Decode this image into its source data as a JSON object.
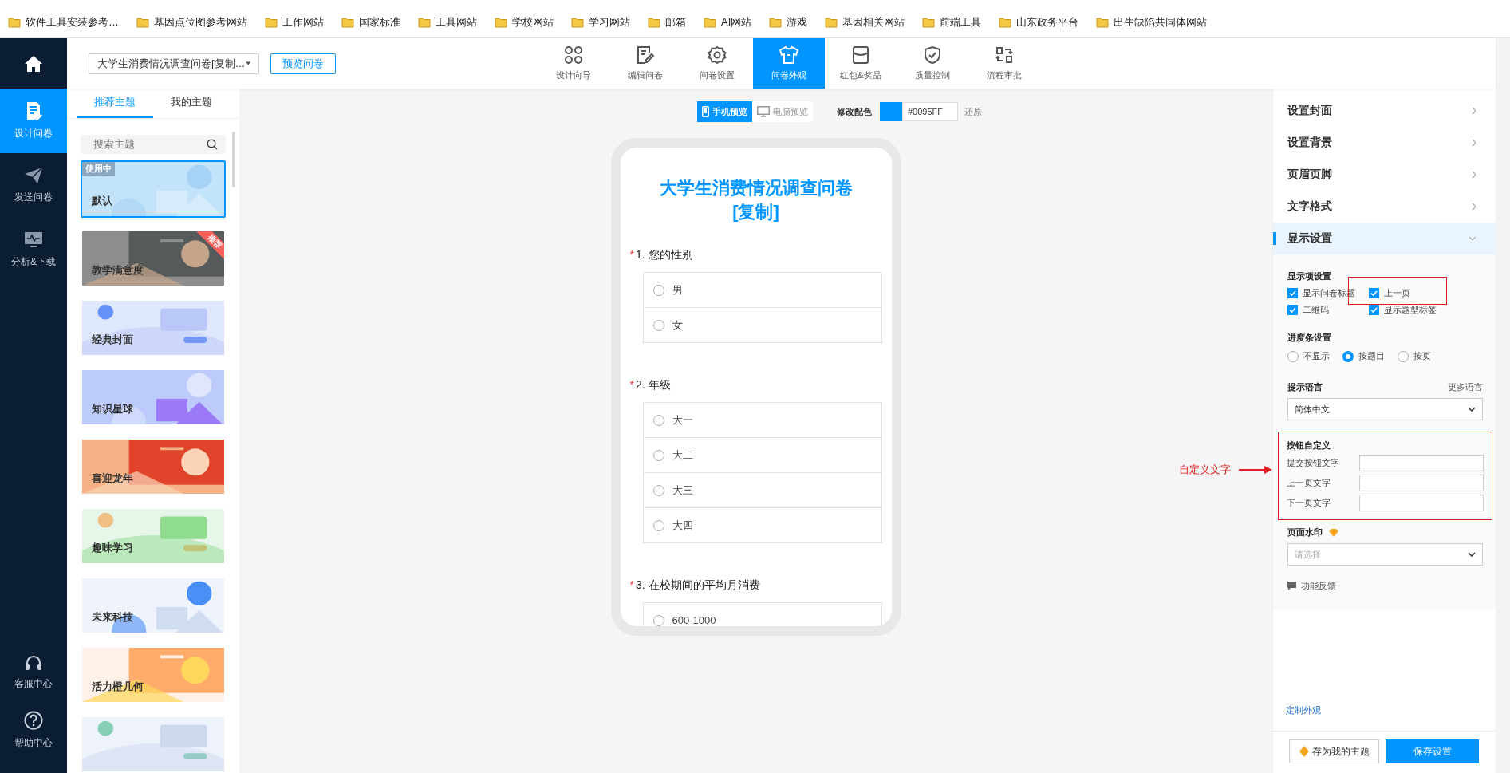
{
  "bookmarks": [
    "软件工具安装参考…",
    "基因点位图参考网站",
    "工作网站",
    "国家标准",
    "工具网站",
    "学校网站",
    "学习网站",
    "邮箱",
    "AI网站",
    "游戏",
    "基因相关网站",
    "前端工具",
    "山东政务平台",
    "出生缺陷共同体网站"
  ],
  "app_nav": {
    "items": [
      {
        "label": "设计问卷",
        "kind": "doc",
        "selected": true
      },
      {
        "label": "发送问卷",
        "kind": "plane",
        "selected": false
      },
      {
        "label": "分析&下载",
        "kind": "monitor",
        "selected": false
      }
    ],
    "bottom": [
      {
        "label": "客服中心",
        "kind": "headset"
      },
      {
        "label": "帮助中心",
        "kind": "help"
      }
    ]
  },
  "header": {
    "survey_select": "大学生消费情况调查问卷[复制…",
    "preview_button": "预览问卷",
    "tabs": [
      {
        "label": "设计向导",
        "kind": "grid",
        "selected": false
      },
      {
        "label": "编辑问卷",
        "kind": "edit",
        "selected": false
      },
      {
        "label": "问卷设置",
        "kind": "gear",
        "selected": false
      },
      {
        "label": "问卷外观",
        "kind": "shirt",
        "selected": true
      },
      {
        "label": "红包&奖品",
        "kind": "box",
        "selected": false
      },
      {
        "label": "质量控制",
        "kind": "shield",
        "selected": false
      },
      {
        "label": "流程审批",
        "kind": "flow",
        "selected": false
      }
    ]
  },
  "theme_panel": {
    "tabs": [
      {
        "label": "推荐主题",
        "selected": true
      },
      {
        "label": "我的主题",
        "selected": false
      }
    ],
    "search": {
      "placeholder": "搜索主题"
    },
    "themes": [
      {
        "label": "默认",
        "badge": "使用中",
        "selected": true
      },
      {
        "label": "教学满意度",
        "tag": "推荐",
        "selected": false
      },
      {
        "label": "经典封面",
        "selected": false
      },
      {
        "label": "知识星球",
        "selected": false
      },
      {
        "label": "喜迎龙年",
        "selected": false
      },
      {
        "label": "趣味学习",
        "selected": false
      },
      {
        "label": "未来科技",
        "selected": false
      },
      {
        "label": "活力橙几何",
        "selected": false
      },
      {
        "selected": false
      }
    ]
  },
  "preview": {
    "modes": [
      {
        "label": "手机预览",
        "kind": "phone",
        "selected": true
      },
      {
        "label": "电脑预览",
        "kind": "desktop",
        "selected": false
      }
    ],
    "color_label": "修改配色",
    "color": "#0095ff",
    "color_value": "#0095FF",
    "reset": "还原",
    "survey": {
      "title": "大学生消费情况调查问卷[复制]",
      "required_mark": "*",
      "questions": [
        {
          "number": "1.",
          "title": "您的性别",
          "required": true,
          "options": [
            "男",
            "女"
          ]
        },
        {
          "number": "2.",
          "title": "年级",
          "required": true,
          "options": [
            "大一",
            "大二",
            "大三",
            "大四"
          ]
        },
        {
          "number": "3.",
          "title": "在校期间的平均月消费",
          "required": true,
          "options": [
            "600-1000"
          ]
        }
      ]
    }
  },
  "settings_panel": {
    "sections": [
      {
        "label": "设置封面",
        "expanded": false
      },
      {
        "label": "设置背景",
        "expanded": false
      },
      {
        "label": "页眉页脚",
        "expanded": false
      },
      {
        "label": "文字格式",
        "expanded": false
      },
      {
        "label": "显示设置",
        "expanded": true
      }
    ],
    "display": {
      "heading": "显示项设置",
      "items": [
        {
          "label": "显示问卷标题",
          "checked": true,
          "highlighted": false
        },
        {
          "label": "上一页",
          "checked": true,
          "highlighted": true
        },
        {
          "label": "二维码",
          "checked": true,
          "highlighted": false
        },
        {
          "label": "显示题型标签",
          "checked": true,
          "highlighted": false
        }
      ]
    },
    "progress": {
      "heading": "进度条设置",
      "options": [
        {
          "label": "不显示",
          "selected": false
        },
        {
          "label": "按题目",
          "selected": true
        },
        {
          "label": "按页",
          "selected": false
        }
      ]
    },
    "language": {
      "heading": "提示语言",
      "more": "更多语言",
      "value": "简体中文"
    },
    "button_text": {
      "heading": "按钮自定义",
      "highlighted": true,
      "fields": [
        {
          "label": "提交按钮文字"
        },
        {
          "label": "上一页文字"
        },
        {
          "label": "下一页文字"
        }
      ]
    },
    "watermark": {
      "heading": "页面水印",
      "placeholder": "请选择"
    },
    "feedback": "功能反馈",
    "custom_link": "定制外观",
    "save_theme": "存为我的主题",
    "save": "保存设置"
  },
  "annotation": {
    "label": "自定义文字"
  }
}
